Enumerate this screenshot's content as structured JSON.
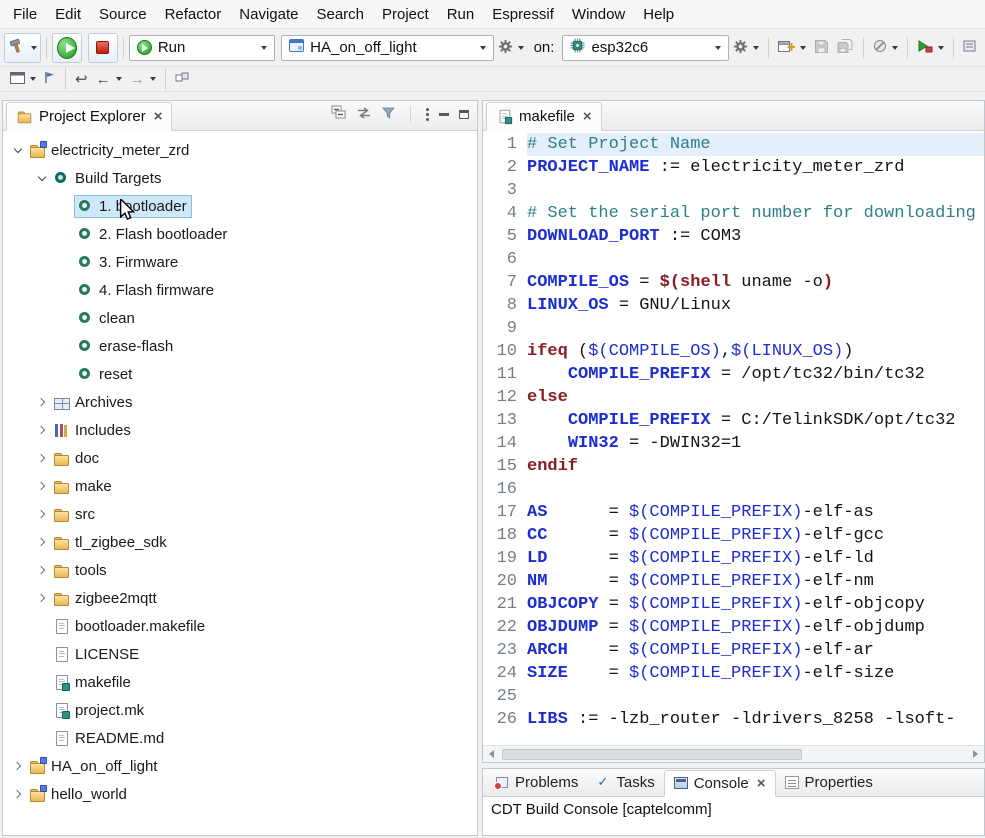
{
  "menu_bar": {
    "items": [
      "File",
      "Edit",
      "Source",
      "Refactor",
      "Navigate",
      "Search",
      "Project",
      "Run",
      "Espressif",
      "Window",
      "Help"
    ]
  },
  "toolbar": {
    "run_mode": "Run",
    "launch_config": "HA_on_off_light",
    "on_label": "on:",
    "target": "esp32c6"
  },
  "icons": {
    "close": "×",
    "back": "←",
    "forward": "→",
    "last_edit": "↩"
  },
  "colors": {
    "tree_selection": "#cfe8f8",
    "current_line": "#e3f0fb",
    "comment": "#2e7f86",
    "definition": "#1c2ed0",
    "keyword": "#8a1c24"
  },
  "project_explorer": {
    "title": "Project Explorer",
    "tree": [
      {
        "label": "electricity_meter_zrd",
        "level": 0,
        "expand": "open",
        "icon": "project"
      },
      {
        "label": "Build Targets",
        "level": 1,
        "expand": "open",
        "icon": "build-targets"
      },
      {
        "label": "1. bootloader",
        "level": 2,
        "expand": "none",
        "icon": "target",
        "selected": true
      },
      {
        "label": "2. Flash bootloader",
        "level": 2,
        "expand": "none",
        "icon": "target"
      },
      {
        "label": "3. Firmware",
        "level": 2,
        "expand": "none",
        "icon": "target"
      },
      {
        "label": "4. Flash firmware",
        "level": 2,
        "expand": "none",
        "icon": "target"
      },
      {
        "label": "clean",
        "level": 2,
        "expand": "none",
        "icon": "target"
      },
      {
        "label": "erase-flash",
        "level": 2,
        "expand": "none",
        "icon": "target"
      },
      {
        "label": "reset",
        "level": 2,
        "expand": "none",
        "icon": "target"
      },
      {
        "label": "Archives",
        "level": 1,
        "expand": "closed",
        "icon": "archives"
      },
      {
        "label": "Includes",
        "level": 1,
        "expand": "closed",
        "icon": "includes"
      },
      {
        "label": "doc",
        "level": 1,
        "expand": "closed",
        "icon": "folder"
      },
      {
        "label": "make",
        "level": 1,
        "expand": "closed",
        "icon": "folder"
      },
      {
        "label": "src",
        "level": 1,
        "expand": "closed",
        "icon": "folder"
      },
      {
        "label": "tl_zigbee_sdk",
        "level": 1,
        "expand": "closed",
        "icon": "folder"
      },
      {
        "label": "tools",
        "level": 1,
        "expand": "closed",
        "icon": "folder"
      },
      {
        "label": "zigbee2mqtt",
        "level": 1,
        "expand": "closed",
        "icon": "folder"
      },
      {
        "label": "bootloader.makefile",
        "level": 1,
        "expand": "none",
        "icon": "file"
      },
      {
        "label": "LICENSE",
        "level": 1,
        "expand": "none",
        "icon": "file"
      },
      {
        "label": "makefile",
        "level": 1,
        "expand": "none",
        "icon": "makefile"
      },
      {
        "label": "project.mk",
        "level": 1,
        "expand": "none",
        "icon": "makefile"
      },
      {
        "label": "README.md",
        "level": 1,
        "expand": "none",
        "icon": "file"
      },
      {
        "label": "HA_on_off_light",
        "level": 0,
        "expand": "closed",
        "icon": "project"
      },
      {
        "label": "hello_world",
        "level": 0,
        "expand": "closed",
        "icon": "project"
      }
    ]
  },
  "editor": {
    "tab": "makefile",
    "first_line": 1,
    "lines": [
      {
        "current": true,
        "tokens": [
          {
            "c": "cm",
            "t": "# Set Project Name"
          }
        ]
      },
      {
        "tokens": [
          {
            "c": "def",
            "t": "PROJECT_NAME"
          },
          {
            "c": "pl",
            "t": " := electricity_meter_zrd"
          }
        ]
      },
      {
        "tokens": []
      },
      {
        "tokens": [
          {
            "c": "cm",
            "t": "# Set the serial port number for downloading"
          }
        ]
      },
      {
        "tokens": [
          {
            "c": "def",
            "t": "DOWNLOAD_PORT"
          },
          {
            "c": "pl",
            "t": " := COM3"
          }
        ]
      },
      {
        "tokens": []
      },
      {
        "tokens": [
          {
            "c": "def",
            "t": "COMPILE_OS"
          },
          {
            "c": "pl",
            "t": " = "
          },
          {
            "c": "kw",
            "t": "$(shell"
          },
          {
            "c": "pl",
            "t": " uname -o"
          },
          {
            "c": "kw",
            "t": ")"
          }
        ]
      },
      {
        "tokens": [
          {
            "c": "def",
            "t": "LINUX_OS"
          },
          {
            "c": "pl",
            "t": " = GNU/Linux"
          }
        ]
      },
      {
        "tokens": []
      },
      {
        "tokens": [
          {
            "c": "kw",
            "t": "ifeq"
          },
          {
            "c": "pl",
            "t": " ("
          },
          {
            "c": "ref",
            "t": "$(COMPILE_OS)"
          },
          {
            "c": "pl",
            "t": ","
          },
          {
            "c": "ref",
            "t": "$(LINUX_OS)"
          },
          {
            "c": "pl",
            "t": ")"
          }
        ]
      },
      {
        "tokens": [
          {
            "c": "pl",
            "t": "    "
          },
          {
            "c": "def",
            "t": "COMPILE_PREFIX"
          },
          {
            "c": "pl",
            "t": " = /opt/tc32/bin/tc32"
          }
        ]
      },
      {
        "tokens": [
          {
            "c": "kw",
            "t": "else"
          }
        ]
      },
      {
        "tokens": [
          {
            "c": "pl",
            "t": "    "
          },
          {
            "c": "def",
            "t": "COMPILE_PREFIX"
          },
          {
            "c": "pl",
            "t": " = C:/TelinkSDK/opt/tc32"
          }
        ]
      },
      {
        "tokens": [
          {
            "c": "pl",
            "t": "    "
          },
          {
            "c": "def",
            "t": "WIN32"
          },
          {
            "c": "pl",
            "t": " = -DWIN32=1"
          }
        ]
      },
      {
        "tokens": [
          {
            "c": "kw",
            "t": "endif"
          }
        ]
      },
      {
        "tokens": []
      },
      {
        "tokens": [
          {
            "c": "def",
            "t": "AS"
          },
          {
            "c": "pl",
            "t": "      = "
          },
          {
            "c": "ref",
            "t": "$(COMPILE_PREFIX)"
          },
          {
            "c": "pl",
            "t": "-elf-as"
          }
        ]
      },
      {
        "tokens": [
          {
            "c": "def",
            "t": "CC"
          },
          {
            "c": "pl",
            "t": "      = "
          },
          {
            "c": "ref",
            "t": "$(COMPILE_PREFIX)"
          },
          {
            "c": "pl",
            "t": "-elf-gcc"
          }
        ]
      },
      {
        "tokens": [
          {
            "c": "def",
            "t": "LD"
          },
          {
            "c": "pl",
            "t": "      = "
          },
          {
            "c": "ref",
            "t": "$(COMPILE_PREFIX)"
          },
          {
            "c": "pl",
            "t": "-elf-ld"
          }
        ]
      },
      {
        "tokens": [
          {
            "c": "def",
            "t": "NM"
          },
          {
            "c": "pl",
            "t": "      = "
          },
          {
            "c": "ref",
            "t": "$(COMPILE_PREFIX)"
          },
          {
            "c": "pl",
            "t": "-elf-nm"
          }
        ]
      },
      {
        "tokens": [
          {
            "c": "def",
            "t": "OBJCOPY"
          },
          {
            "c": "pl",
            "t": " = "
          },
          {
            "c": "ref",
            "t": "$(COMPILE_PREFIX)"
          },
          {
            "c": "pl",
            "t": "-elf-objcopy"
          }
        ]
      },
      {
        "tokens": [
          {
            "c": "def",
            "t": "OBJDUMP"
          },
          {
            "c": "pl",
            "t": " = "
          },
          {
            "c": "ref",
            "t": "$(COMPILE_PREFIX)"
          },
          {
            "c": "pl",
            "t": "-elf-objdump"
          }
        ]
      },
      {
        "tokens": [
          {
            "c": "def",
            "t": "ARCH"
          },
          {
            "c": "pl",
            "t": "    = "
          },
          {
            "c": "ref",
            "t": "$(COMPILE_PREFIX)"
          },
          {
            "c": "pl",
            "t": "-elf-ar"
          }
        ]
      },
      {
        "tokens": [
          {
            "c": "def",
            "t": "SIZE"
          },
          {
            "c": "pl",
            "t": "    = "
          },
          {
            "c": "ref",
            "t": "$(COMPILE_PREFIX)"
          },
          {
            "c": "pl",
            "t": "-elf-size"
          }
        ]
      },
      {
        "tokens": []
      },
      {
        "tokens": [
          {
            "c": "def",
            "t": "LIBS"
          },
          {
            "c": "pl",
            "t": " := -lzb_router -ldrivers_8258 -lsoft-"
          }
        ]
      }
    ]
  },
  "bottom": {
    "tabs": [
      "Problems",
      "Tasks",
      "Console",
      "Properties"
    ],
    "active_tab": "Console",
    "console_text": "CDT Build Console [captelcomm]"
  }
}
